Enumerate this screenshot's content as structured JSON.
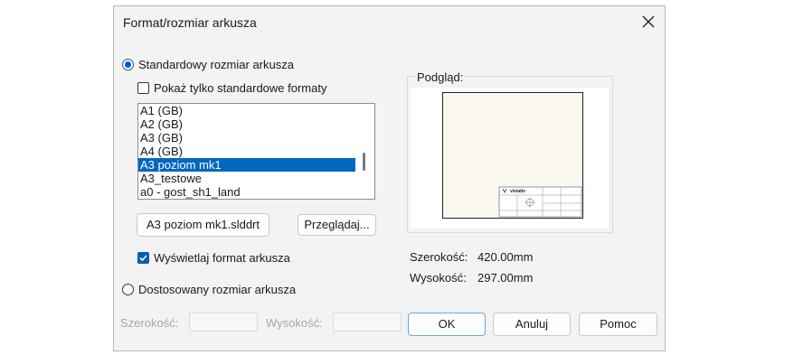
{
  "dialog": {
    "title": "Format/rozmiar arkusza",
    "standard_radio_label": "Standardowy rozmiar arkusza",
    "show_only_standard_label": "Pokaż tylko standardowe formaty",
    "formats": [
      "A1 (GB)",
      "A2 (GB)",
      "A3 (GB)",
      "A4 (GB)",
      "A3 poziom mk1",
      "A3_testowe",
      "a0 - gost_sh1_land"
    ],
    "selected_format_index": 4,
    "template_file_label": "A3 poziom mk1.slddrt",
    "browse_button": "Przeglądaj...",
    "show_format_label": "Wyświetlaj format arkusza",
    "custom_radio_label": "Dostosowany rozmiar arkusza",
    "custom_width_label": "Szerokość:",
    "custom_height_label": "Wysokość:",
    "preview_label": "Podgląd:",
    "width_label": "Szerokość:",
    "width_value": "420.00mm",
    "height_label": "Wysokość:",
    "height_value": "297.00mm",
    "ok_button": "OK",
    "cancel_button": "Anuluj",
    "help_button": "Pomoc",
    "preview_logo_text": "visiativ"
  }
}
